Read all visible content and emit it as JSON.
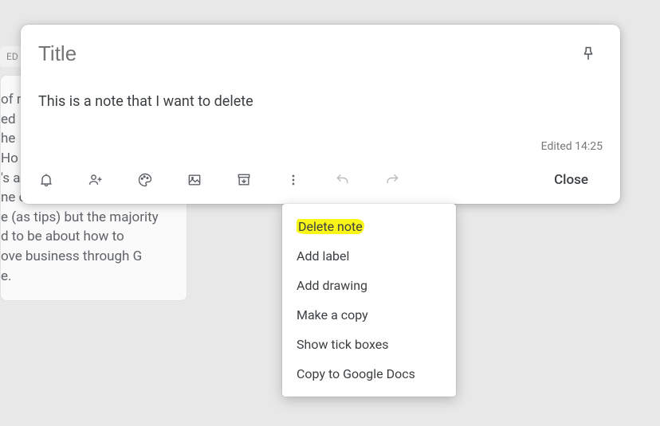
{
  "bg": {
    "chip": "ED",
    "card_text": "of n\ned\n he\n Ho\n's a\nne can write those. I'll do\ne (as tips) but the majority\nd to be about how to\nove business through G\ne."
  },
  "note": {
    "title_placeholder": "Title",
    "title_value": "",
    "body": "This is a note that I want to delete",
    "edited": "Edited 14:25",
    "close": "Close"
  },
  "menu": {
    "items": [
      "Delete note",
      "Add label",
      "Add drawing",
      "Make a copy",
      "Show tick boxes",
      "Copy to Google Docs"
    ],
    "highlighted_index": 0
  }
}
